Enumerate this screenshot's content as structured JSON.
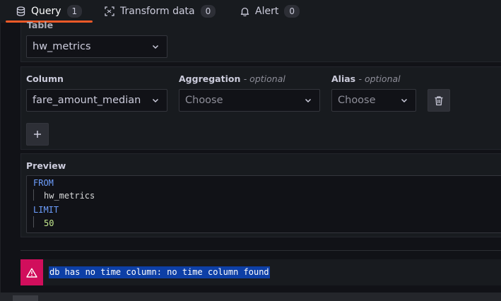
{
  "tabs": [
    {
      "label": "Query",
      "count": "1",
      "icon": "database-icon",
      "active": true
    },
    {
      "label": "Transform data",
      "count": "0",
      "icon": "transform-icon",
      "active": false
    },
    {
      "label": "Alert",
      "count": "0",
      "icon": "bell-icon",
      "active": false
    }
  ],
  "table_section": {
    "label": "Table",
    "selected": "hw_metrics"
  },
  "column_section": {
    "column_label": "Column",
    "column_value": "fare_amount_median",
    "aggregation_label": "Aggregation",
    "aggregation_optional": "- optional",
    "aggregation_placeholder": "Choose",
    "alias_label": "Alias",
    "alias_optional": "- optional",
    "alias_placeholder": "Choose"
  },
  "preview": {
    "label": "Preview",
    "lines": [
      "FROM",
      "hw_metrics",
      "LIMIT",
      "50"
    ]
  },
  "alert": {
    "message": "db has no time column: no time column found"
  },
  "colors": {
    "accent": "#f05a28",
    "error": "#d10e5c",
    "keyword": "#6e9fff",
    "number": "#c3e88d",
    "selection": "#0d3fa6"
  }
}
